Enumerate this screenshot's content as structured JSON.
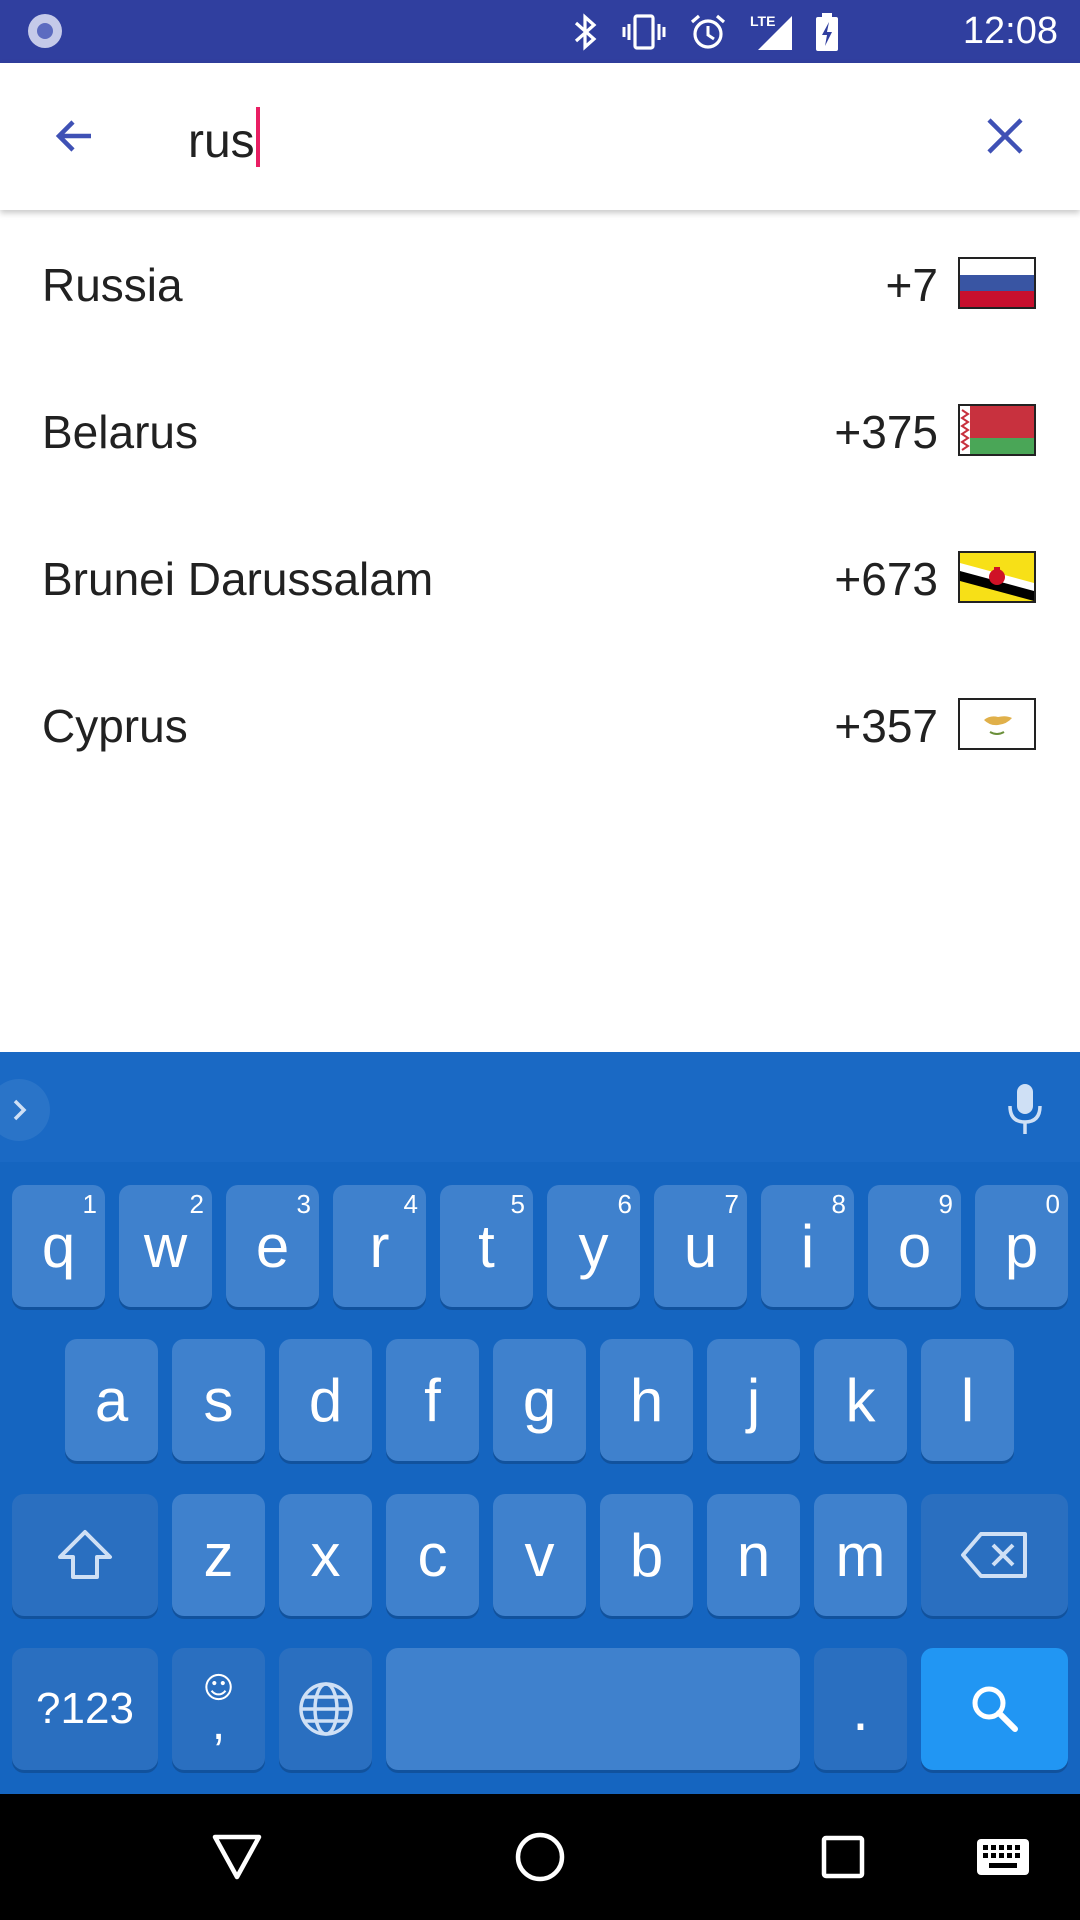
{
  "status_bar": {
    "time": "12:08",
    "icons": [
      "app-notification-icon",
      "bluetooth-icon",
      "vibrate-icon",
      "alarm-icon",
      "lte-signal-icon",
      "battery-charging-icon"
    ],
    "network_label": "LTE"
  },
  "search": {
    "query": "rus",
    "back_icon": "arrow-back-icon",
    "clear_icon": "close-icon",
    "cursor_color": "#e91e63"
  },
  "results": [
    {
      "name": "Russia",
      "code": "+7",
      "flag": "russia-flag"
    },
    {
      "name": "Belarus",
      "code": "+375",
      "flag": "belarus-flag"
    },
    {
      "name": "Brunei Darussalam",
      "code": "+673",
      "flag": "brunei-flag"
    },
    {
      "name": "Cyprus",
      "code": "+357",
      "flag": "cyprus-flag"
    }
  ],
  "keyboard": {
    "row1": [
      {
        "k": "q",
        "h": "1"
      },
      {
        "k": "w",
        "h": "2"
      },
      {
        "k": "e",
        "h": "3"
      },
      {
        "k": "r",
        "h": "4"
      },
      {
        "k": "t",
        "h": "5"
      },
      {
        "k": "y",
        "h": "6"
      },
      {
        "k": "u",
        "h": "7"
      },
      {
        "k": "i",
        "h": "8"
      },
      {
        "k": "o",
        "h": "9"
      },
      {
        "k": "p",
        "h": "0"
      }
    ],
    "row2": [
      "a",
      "s",
      "d",
      "f",
      "g",
      "h",
      "j",
      "k",
      "l"
    ],
    "row3": [
      "z",
      "x",
      "c",
      "v",
      "b",
      "n",
      "m"
    ],
    "symbols_label": "?123",
    "comma_label": ",",
    "emoji_label": "☺",
    "period_label": ".",
    "colors": {
      "background": "#1565c0",
      "key": "#3f81cd",
      "action": "#2196f3"
    }
  },
  "colors": {
    "status_bar": "#303f9f",
    "accent": "#3f51b5"
  }
}
